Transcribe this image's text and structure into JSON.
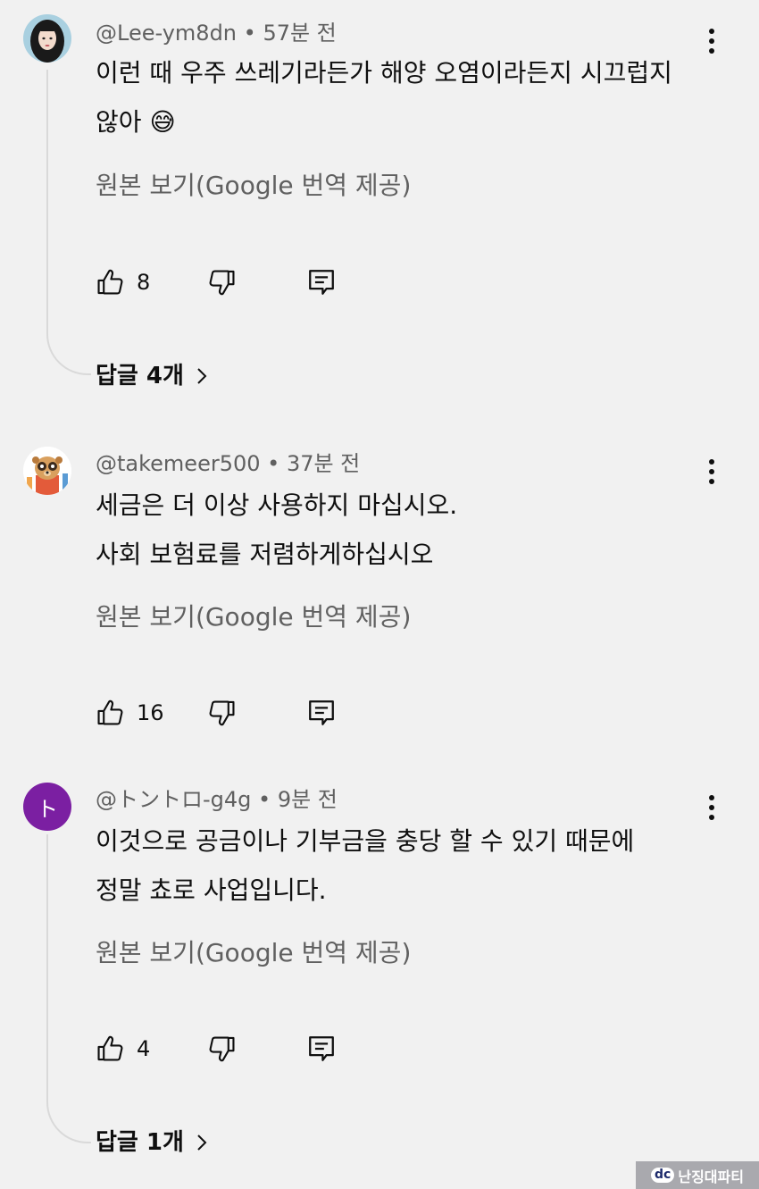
{
  "comments": [
    {
      "handle": "@Lee-ym8dn",
      "separator": " • ",
      "time": "57분 전",
      "lines": [
        "이런 때 우주 쓰레기라든가 해양 오염이라든지 시끄럽지",
        "않아"
      ],
      "emoji": "😅",
      "translate_label": "원본 보기(Google 번역 제공)",
      "likes": "8",
      "replies_label": "답글 4개",
      "avatar_kind": "photo"
    },
    {
      "handle": "@takemeer500",
      "separator": " • ",
      "time": "37분 전",
      "lines": [
        "세금은 더 이상 사용하지 마십시오.",
        "사회 보험료를 저렴하게하십시오"
      ],
      "translate_label": "원본 보기(Google 번역 제공)",
      "likes": "16",
      "avatar_kind": "meerkat"
    },
    {
      "handle": "@トントロ-g4g",
      "separator": " • ",
      "time": "9분 전",
      "lines": [
        "이것으로 공금이나 기부금을 충당 할 수 있기 때문에",
        "정말 쵸로 사업입니다."
      ],
      "translate_label": "원본 보기(Google 번역 제공)",
      "likes": "4",
      "replies_label": "답글 1개",
      "avatar_letter": "ト",
      "avatar_color": "#7b1fa2"
    }
  ],
  "icons": {
    "like": "thumbs-up-icon",
    "dislike": "thumbs-down-icon",
    "reply": "reply-comment-icon",
    "more": "more-vertical-icon",
    "replies_chevron": "chevron-right-icon"
  },
  "watermark": {
    "logo": "dc",
    "text": "난징대파티"
  }
}
